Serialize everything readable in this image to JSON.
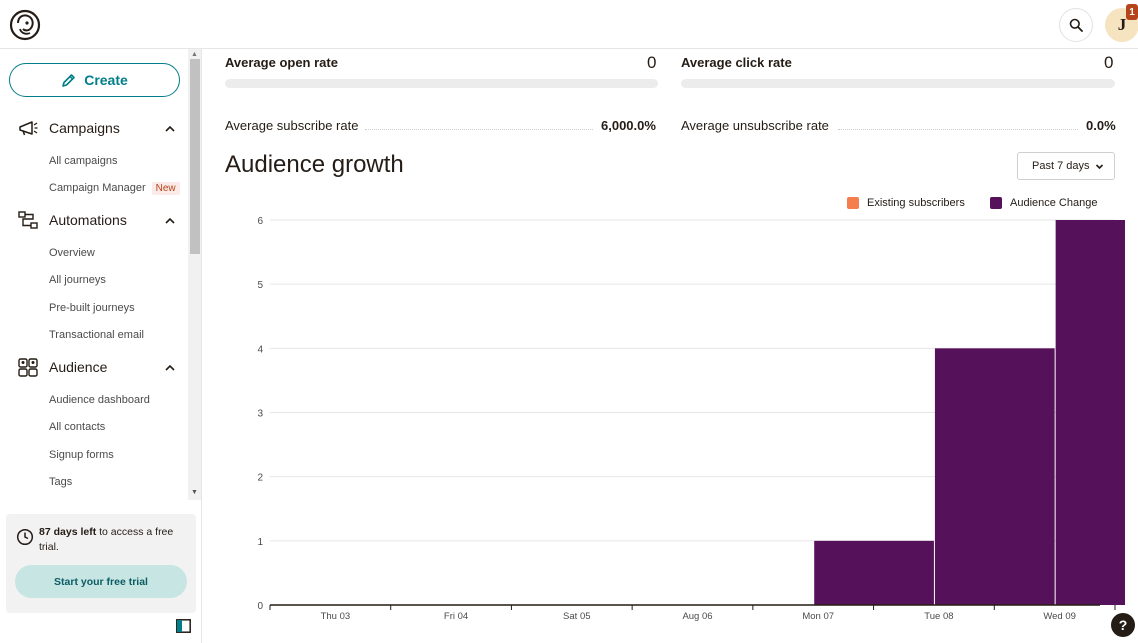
{
  "header": {
    "search_icon": "search-icon",
    "avatar_letter": "J",
    "notification_count": "1"
  },
  "sidebar": {
    "create_label": "Create",
    "sections": [
      {
        "label": "Campaigns",
        "items": [
          "All campaigns",
          "Campaign Manager"
        ],
        "new_badge": "New"
      },
      {
        "label": "Automations",
        "items": [
          "Overview",
          "All journeys",
          "Pre-built journeys",
          "Transactional email"
        ]
      },
      {
        "label": "Audience",
        "items": [
          "Audience dashboard",
          "All contacts",
          "Signup forms",
          "Tags"
        ]
      }
    ],
    "trial": {
      "days_bold": "87 days left",
      "rest": " to access a free trial.",
      "button": "Start your free trial"
    }
  },
  "stats": {
    "open_rate_label": "Average open rate",
    "open_rate_value": "0",
    "click_rate_label": "Average click rate",
    "click_rate_value": "0",
    "subscribe_label": "Average subscribe rate",
    "subscribe_value": "6,000.0%",
    "unsubscribe_label": "Average unsubscribe rate",
    "unsubscribe_value": "0.0%"
  },
  "growth": {
    "title": "Audience growth",
    "range_select": "Past 7 days",
    "legend": [
      {
        "name": "Existing subscribers",
        "color": "#f47f4d"
      },
      {
        "name": "Audience Change",
        "color": "#55125a"
      }
    ]
  },
  "chart_data": {
    "type": "bar",
    "categories": [
      "Thu 03",
      "Fri 04",
      "Sat 05",
      "Aug 06",
      "Mon 07",
      "Tue 08",
      "Wed 09"
    ],
    "series": [
      {
        "name": "Existing subscribers",
        "values": [
          0,
          0,
          0,
          0,
          0,
          0,
          0
        ]
      },
      {
        "name": "Audience Change",
        "values": [
          0,
          0,
          0,
          0,
          1,
          4,
          6
        ]
      }
    ],
    "yticks": [
      "0",
      "1",
      "2",
      "3",
      "4",
      "5",
      "6"
    ],
    "ylim": [
      0,
      6
    ],
    "grid": true,
    "legend_position": "top-right"
  },
  "help_label": "?"
}
